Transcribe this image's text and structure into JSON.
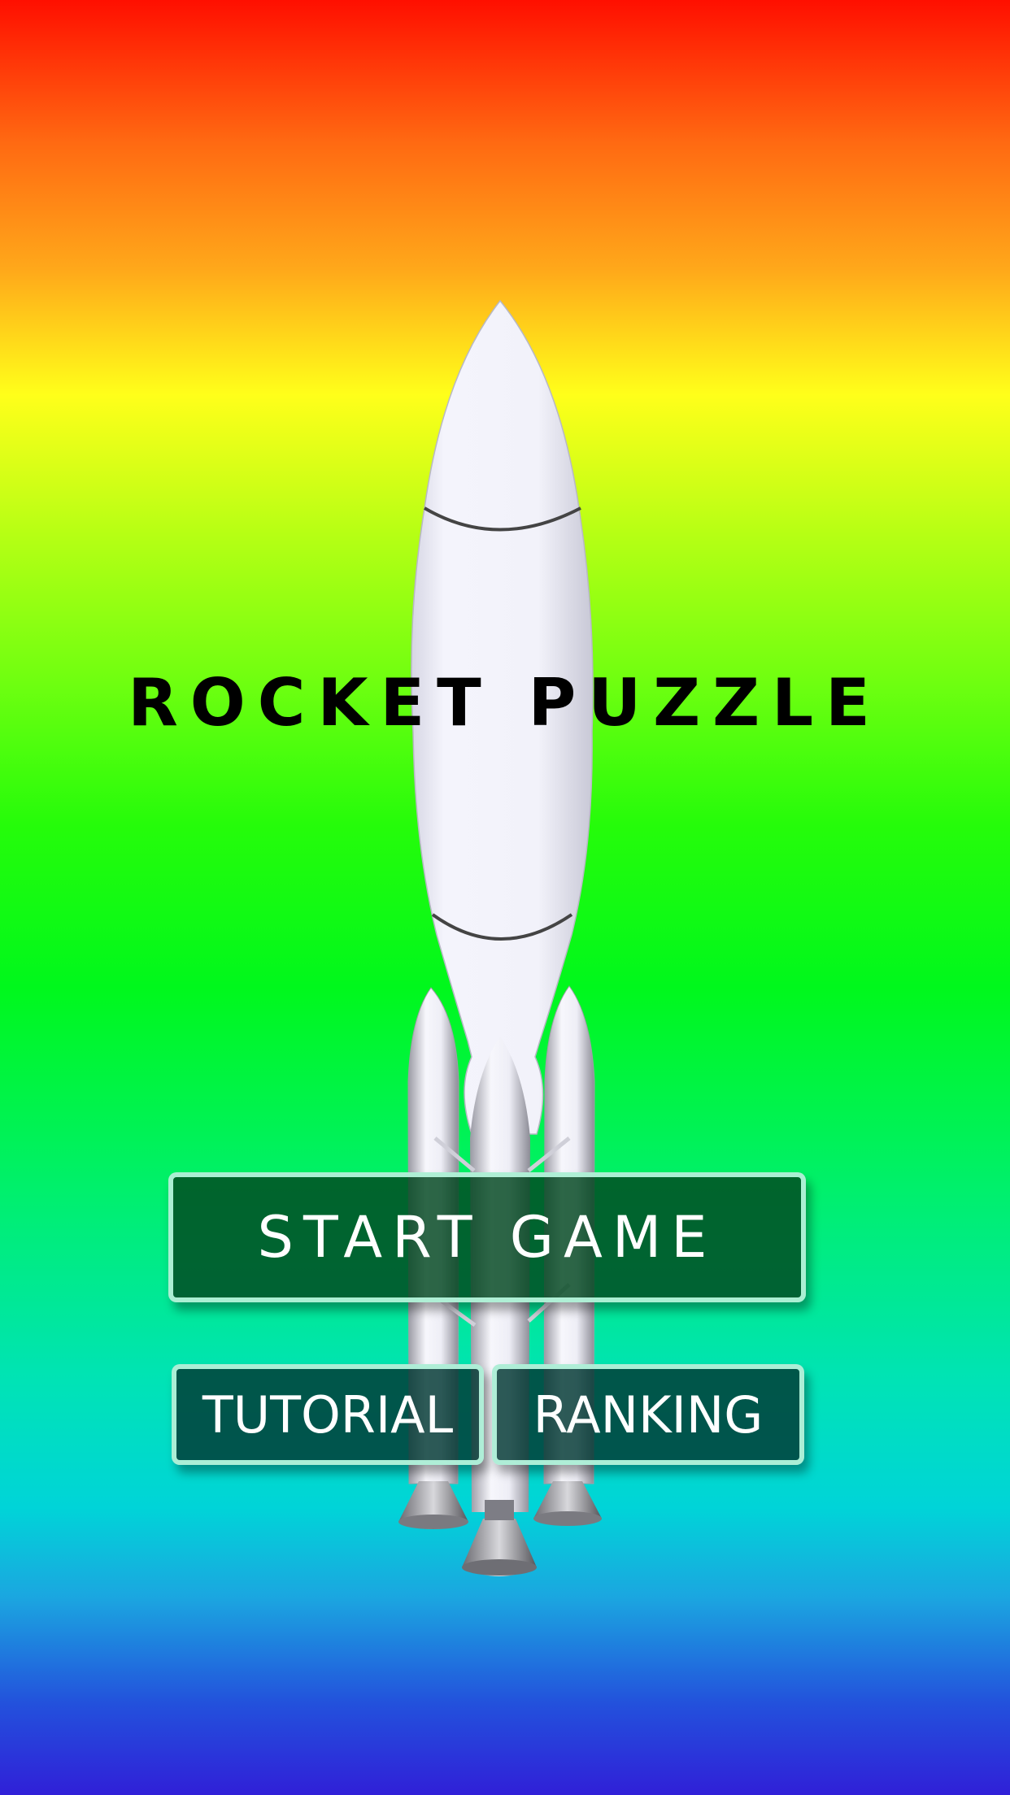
{
  "title": "ROCKET PUZZLE",
  "menu": {
    "start_label": "START GAME",
    "tutorial_label": "TUTORIAL",
    "ranking_label": "RANKING"
  },
  "colors": {
    "button_fill": "#00461e",
    "button_border": "#bfffe6",
    "title_text": "#000000"
  },
  "icons": [
    "rocket-illustration"
  ]
}
